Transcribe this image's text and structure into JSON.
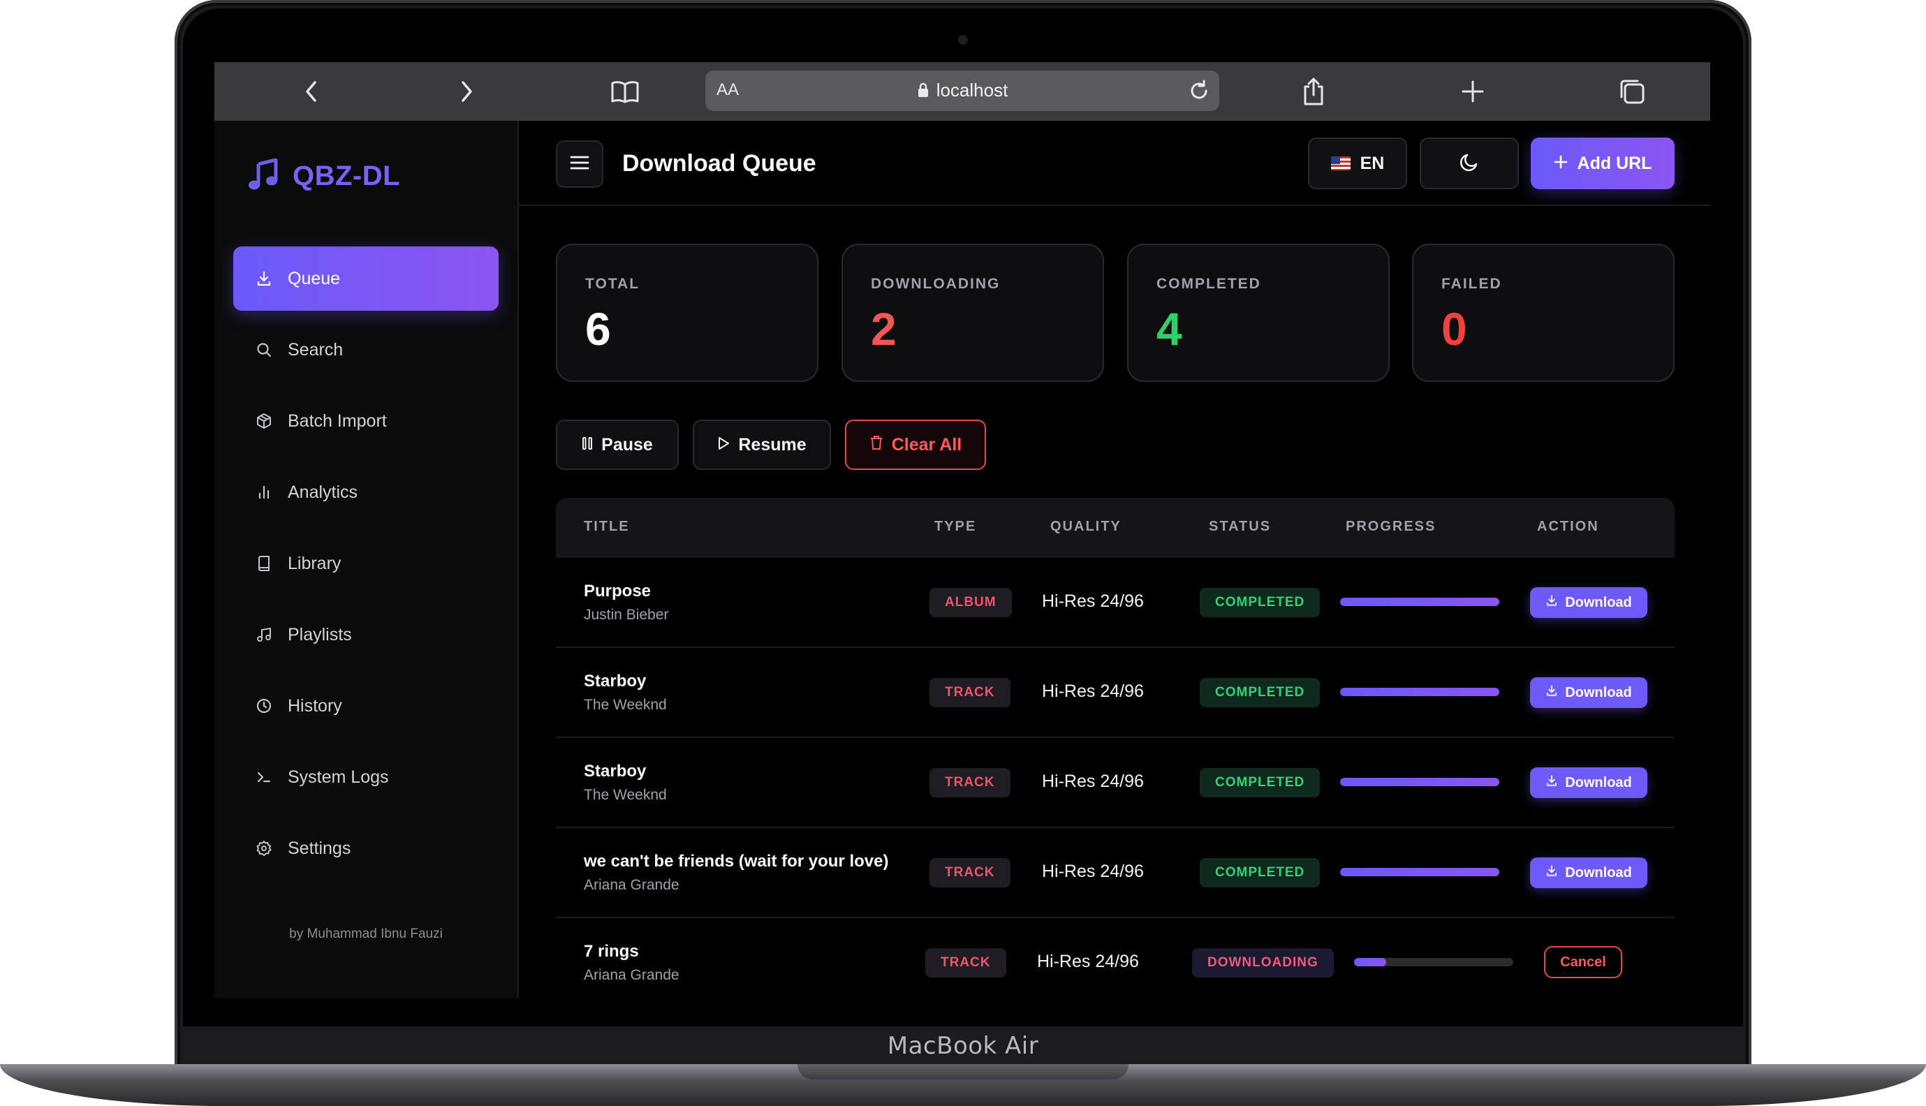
{
  "device": {
    "label": "MacBook Air"
  },
  "browser": {
    "text_size_label": "AA",
    "url": "localhost"
  },
  "sidebar": {
    "brand": "QBZ-DL",
    "items": [
      {
        "label": "Queue",
        "icon": "download-icon",
        "active": true
      },
      {
        "label": "Search",
        "icon": "search-icon"
      },
      {
        "label": "Batch Import",
        "icon": "package-icon"
      },
      {
        "label": "Analytics",
        "icon": "bar-chart-icon"
      },
      {
        "label": "Library",
        "icon": "book-icon"
      },
      {
        "label": "Playlists",
        "icon": "music-note-icon"
      },
      {
        "label": "History",
        "icon": "clock-icon"
      },
      {
        "label": "System Logs",
        "icon": "terminal-icon"
      },
      {
        "label": "Settings",
        "icon": "gear-icon"
      }
    ],
    "credit": "by Muhammad Ibnu Fauzi"
  },
  "header": {
    "title": "Download Queue",
    "language": "EN",
    "add_url_label": "Add URL"
  },
  "stats": [
    {
      "label": "TOTAL",
      "value": "6",
      "color": "#ffffff"
    },
    {
      "label": "DOWNLOADING",
      "value": "2",
      "color": "#f05656"
    },
    {
      "label": "COMPLETED",
      "value": "4",
      "color": "#2fcf6a"
    },
    {
      "label": "FAILED",
      "value": "0",
      "color": "#f0413f"
    }
  ],
  "actions": {
    "pause": "Pause",
    "resume": "Resume",
    "clear_all": "Clear All"
  },
  "table": {
    "columns": [
      "TITLE",
      "TYPE",
      "QUALITY",
      "STATUS",
      "PROGRESS",
      "ACTION"
    ],
    "rows": [
      {
        "title": "Purpose",
        "artist": "Justin Bieber",
        "type": "ALBUM",
        "quality": "Hi-Res 24/96",
        "status": "COMPLETED",
        "progress": 100,
        "action": "Download"
      },
      {
        "title": "Starboy",
        "artist": "The Weeknd",
        "type": "TRACK",
        "quality": "Hi-Res 24/96",
        "status": "COMPLETED",
        "progress": 100,
        "action": "Download"
      },
      {
        "title": "Starboy",
        "artist": "The Weeknd",
        "type": "TRACK",
        "quality": "Hi-Res 24/96",
        "status": "COMPLETED",
        "progress": 100,
        "action": "Download"
      },
      {
        "title": "we can't be friends (wait for your love)",
        "artist": "Ariana Grande",
        "type": "TRACK",
        "quality": "Hi-Res 24/96",
        "status": "COMPLETED",
        "progress": 100,
        "action": "Download"
      },
      {
        "title": "7 rings",
        "artist": "Ariana Grande",
        "type": "TRACK",
        "quality": "Hi-Res 24/96",
        "status": "DOWNLOADING",
        "progress": 20,
        "action": "Cancel"
      }
    ]
  },
  "colors": {
    "accent": "#6d5af8",
    "danger": "#e5484d",
    "success": "#34d17a"
  }
}
